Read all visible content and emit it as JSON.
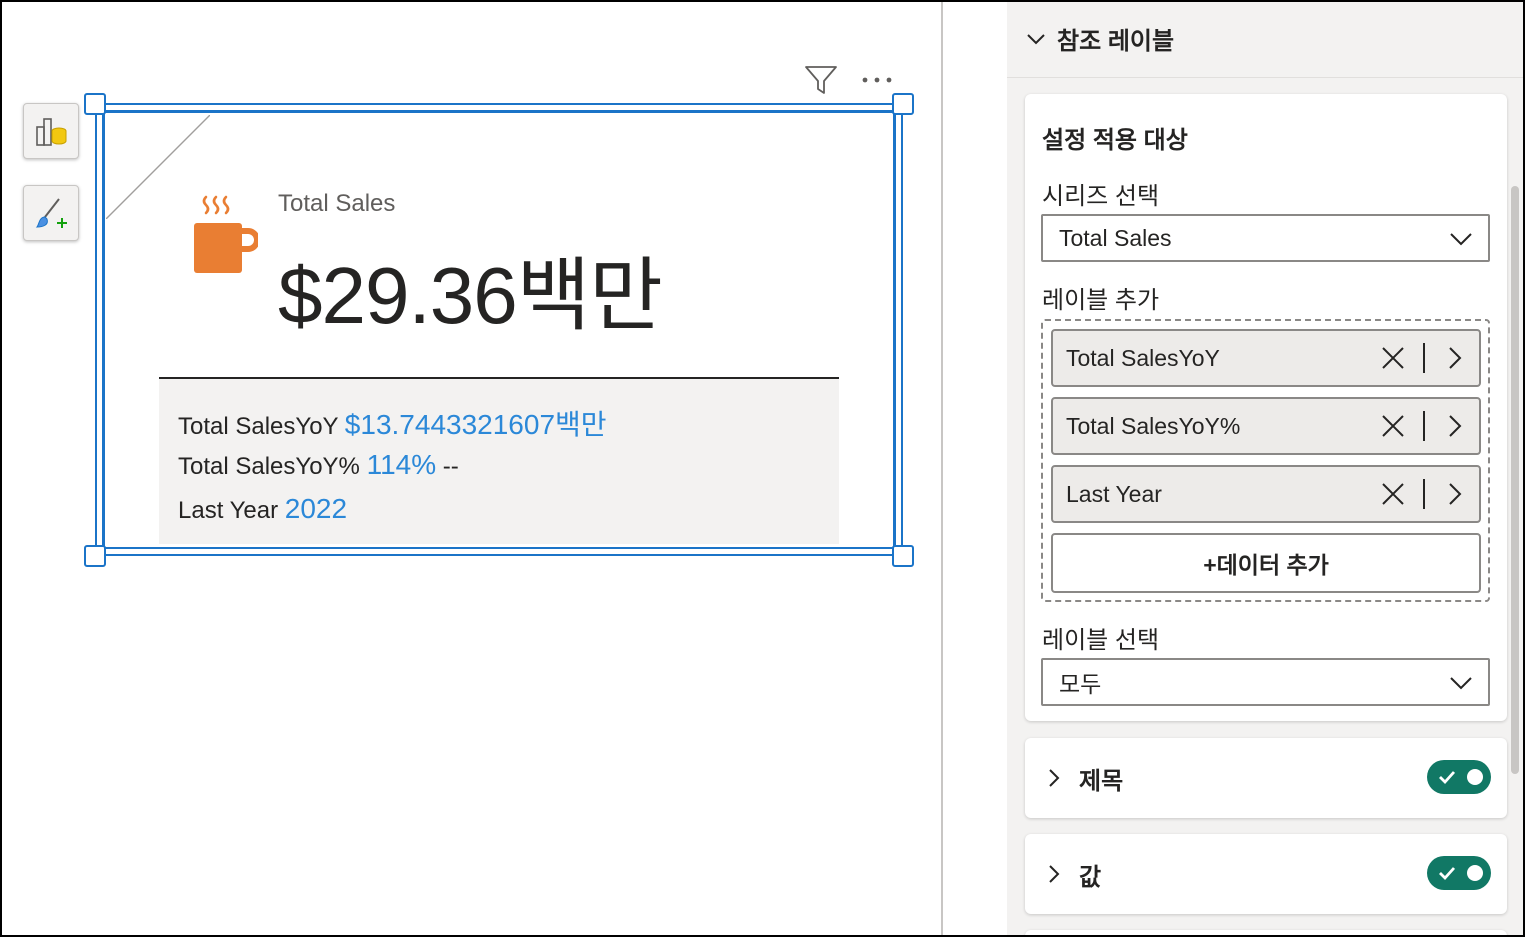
{
  "visual": {
    "kpi_label": "Total Sales",
    "kpi_value": "$29.36백만",
    "reference_labels": [
      {
        "name": "Total SalesYoY",
        "value": "$13.7443321607백만",
        "suffix": ""
      },
      {
        "name": "Total SalesYoY%",
        "value": "114%",
        "suffix": " --"
      },
      {
        "name": "Last Year",
        "value": "2022",
        "suffix": ""
      }
    ],
    "header_icons": [
      "filter-icon",
      "more-options-icon"
    ],
    "accent_color": "#1b74c8",
    "value_color": "#2b88d8",
    "mug_color": "#e97e33"
  },
  "left_toolbar": {
    "buttons": [
      "build-visual-icon",
      "format-visual-icon"
    ]
  },
  "format_pane": {
    "section_title": "참조 레이블",
    "apply_settings": {
      "title": "설정 적용 대상",
      "series_label": "시리즈 선택",
      "series_value": "Total Sales",
      "add_label_title": "레이블 추가",
      "labels": [
        "Total SalesYoY",
        "Total SalesYoY%",
        "Last Year"
      ],
      "add_data_button": "+데이터 추가",
      "label_select_title": "레이블 선택",
      "label_select_value": "모두"
    },
    "collapsed_sections": [
      {
        "label": "제목",
        "enabled": true
      },
      {
        "label": "값",
        "enabled": true
      }
    ],
    "toggle_color": "#117865"
  }
}
